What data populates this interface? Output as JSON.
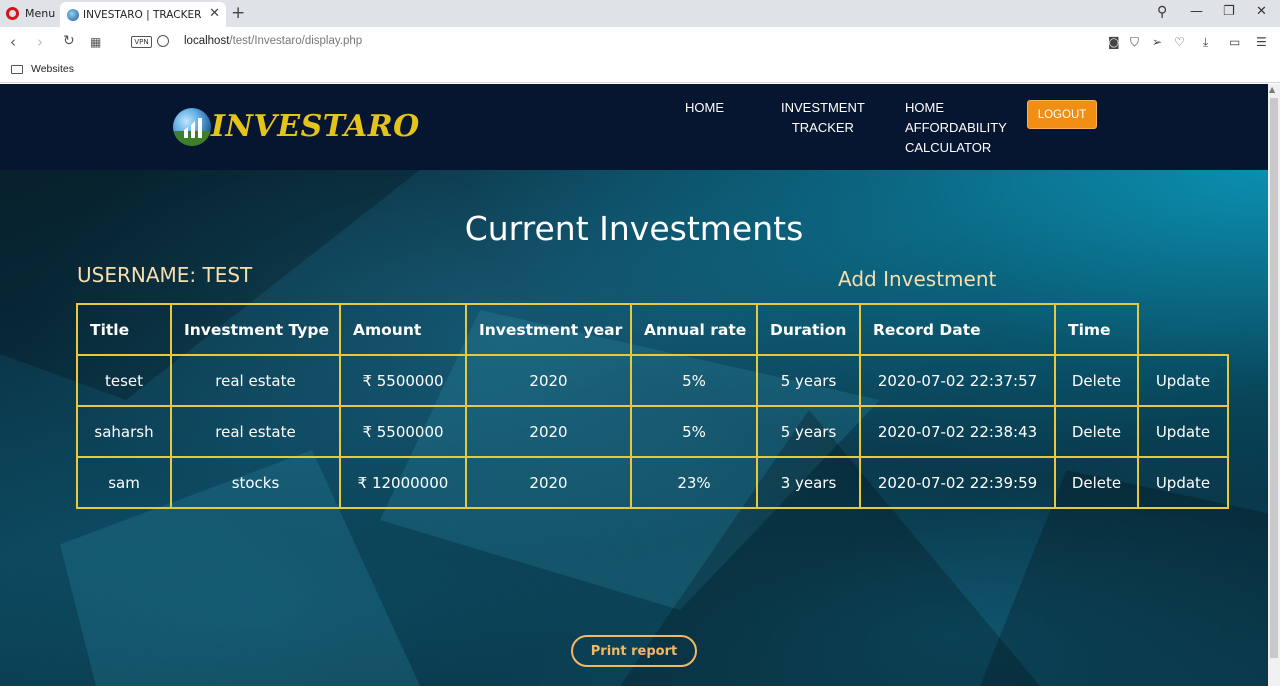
{
  "browser": {
    "menu_label": "Menu",
    "tab_title": "INVESTARO | TRACKER",
    "url_host": "localhost",
    "url_path": "/test/Investaro/display.php",
    "vpn_label": "VPN",
    "bookmark_folder": "Websites"
  },
  "site": {
    "logo_text": "INVESTARO",
    "nav": {
      "home": "HOME",
      "tracker_line1": "INVESTMENT",
      "tracker_line2": "TRACKER",
      "afford_line1": "HOME",
      "afford_line2": "AFFORDABILITY",
      "afford_line3": "CALCULATOR"
    },
    "logout_label": "LOGOUT"
  },
  "main": {
    "title": "Current Investments",
    "username_label": "USERNAME: TEST",
    "add_link": "Add Investment",
    "table": {
      "headers": [
        "Title",
        "Investment Type",
        "Amount",
        "Investment year",
        "Annual rate",
        "Duration",
        "Record Date",
        "Time"
      ],
      "rows": [
        {
          "title": "teset",
          "type": "real estate",
          "amount": "₹ 5500000",
          "year": "2020",
          "rate": "5%",
          "duration": "5 years",
          "record_date": "2020-07-02 22:37:57",
          "delete": "Delete",
          "update": "Update"
        },
        {
          "title": "saharsh",
          "type": "real estate",
          "amount": "₹ 5500000",
          "year": "2020",
          "rate": "5%",
          "duration": "5 years",
          "record_date": "2020-07-02 22:38:43",
          "delete": "Delete",
          "update": "Update"
        },
        {
          "title": "sam",
          "type": "stocks",
          "amount": "₹ 12000000",
          "year": "2020",
          "rate": "23%",
          "duration": "3 years",
          "record_date": "2020-07-02 22:39:59",
          "delete": "Delete",
          "update": "Update"
        }
      ]
    },
    "print_label": "Print report"
  },
  "colors": {
    "header_bg": "#061631",
    "logo_gold": "#e4c41a",
    "logout_orange": "#f28e13",
    "table_border": "#e7c93b",
    "accent_text": "#f6deb0"
  }
}
